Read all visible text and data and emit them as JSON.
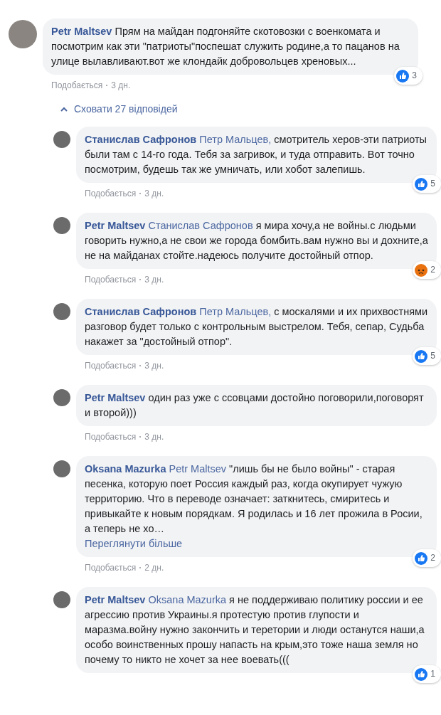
{
  "comment": {
    "author": "Petr Maltsev",
    "text": "Прям на майдан подгоняйте скотовозки с военкомата и посмотрим как эти \"патриоты\"поспешат служить родине,а то пацанов на улице вылавливают.вот же клондайк добровольцев хреновых...",
    "reaction": {
      "kind": "like",
      "count": "3"
    },
    "like_label": "Подобається",
    "time": "3 дн."
  },
  "replies_toggle": "Сховати 27 відповідей",
  "replies": [
    {
      "author": "Станислав Сафронов",
      "mention": "Петр Мальцев,",
      "text": "смотритель херов-эти патриоты были там с 14-го года. Тебя за загривок, и туда отправить. Вот точно посмотрим, будешь так же умничать, или хобот залепишь.",
      "reaction": {
        "kind": "like",
        "count": "5"
      },
      "like_label": "Подобається",
      "time": "3 дн."
    },
    {
      "author": "Petr Maltsev",
      "mention": "Станислав Сафронов",
      "text": "я мира хочу,а не войны.с людьми говорить нужно,а не свои же города бомбить.вам нужно вы и дохните,а не на майданах стойте.надеюсь получите достойный отпор.",
      "reaction": {
        "kind": "angry",
        "count": "2"
      },
      "like_label": "Подобається",
      "time": "3 дн."
    },
    {
      "author": "Станислав Сафронов",
      "mention": "Петр Мальцев,",
      "text": "с москалями и их прихвостнями разговор будет только с контрольным выстрелом. Тебя, сепар, Судьба накажет за \"достойный отпор\".",
      "reaction": {
        "kind": "like",
        "count": "5"
      },
      "like_label": "Подобається",
      "time": "3 дн."
    },
    {
      "author": "Petr Maltsev",
      "text": "один раз уже с ссовцами достойно поговорили,поговорят и второй)))",
      "like_label": "Подобається",
      "time": "3 дн."
    },
    {
      "author": "Oksana Mazurka",
      "mention": "Petr Maltsev",
      "text": "\"лишь бы не было войны\" - старая песенка, которую поет Россия каждый раз, когда окупирует чужую территорию. Что в переводе означает: заткнитесь, смиритесь и привыкайте к новым порядкам. Я родилась и 16 лет прожила в Росии, а теперь не хо…",
      "see_more": "Переглянути більше",
      "reaction": {
        "kind": "like",
        "count": "2"
      },
      "like_label": "Подобається",
      "time": "2 дн."
    },
    {
      "author": "Petr Maltsev",
      "mention": "Oksana Mazurka",
      "text": "я не поддерживаю политику россии и ее агрессию против Украины.я протестую против глупости и маразма.войну нужно закончить и теретории и люди останутся наши,а особо воинственных прошу напасть на крым,это тоже наша земля но почему то никто не хочет за нее воевать(((",
      "reaction": {
        "kind": "like",
        "count": "1"
      }
    }
  ]
}
